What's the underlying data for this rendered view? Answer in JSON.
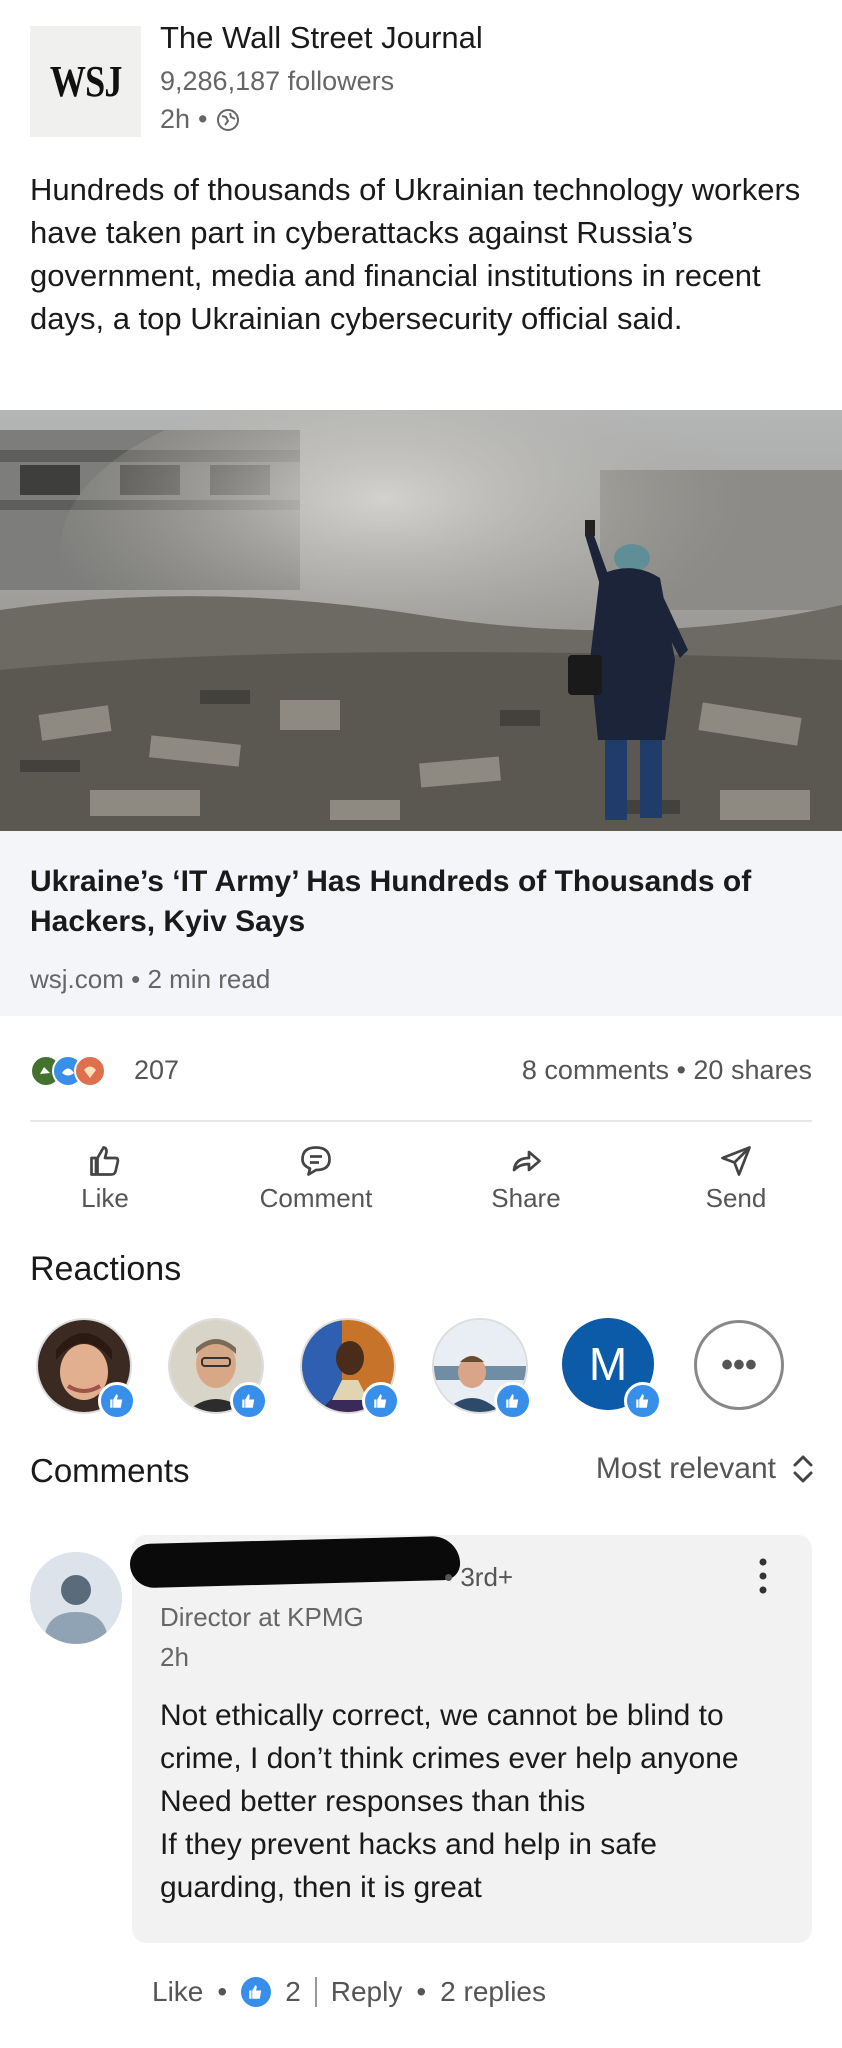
{
  "post": {
    "author": "The Wall Street Journal",
    "logo_text": "WSJ",
    "followers": "9,286,187 followers",
    "time": "2h",
    "separator": "•",
    "visibility_icon": "globe-icon",
    "text": "Hundreds of thousands of Ukrainian technology workers have taken part in cyberattacks against Russia’s government, media and financial institutions in recent days, a top Ukrainian cybersecurity official said."
  },
  "article": {
    "title": "Ukraine’s ‘IT Army’ Has Hundreds of Thousands of Hackers, Kyiv Says",
    "source": "wsj.com • 2 min read"
  },
  "engagement": {
    "reaction_count": "207",
    "comments_shares": "8 comments • 20 shares"
  },
  "actions": {
    "like": "Like",
    "comment": "Comment",
    "share": "Share",
    "send": "Send"
  },
  "reactions": {
    "heading": "Reactions",
    "m_initial": "M",
    "more": "•••"
  },
  "comments": {
    "heading": "Comments",
    "sort": "Most relevant",
    "item": {
      "degree": "• 3rd+",
      "title": "Director at KPMG",
      "time": "2h",
      "text_lines": [
        "Not ethically correct, we cannot be blind to",
        "crime, I don’t think crimes ever help anyone",
        "Need better responses than this",
        "If they prevent hacks and help in safe",
        "guarding, then it is great"
      ],
      "like": "Like",
      "dot": "•",
      "like_count": "2",
      "reply": "Reply",
      "replies": "2 replies"
    }
  },
  "colors": {
    "accent": "#378fe9",
    "member_avatar": "#0b5ba8"
  }
}
